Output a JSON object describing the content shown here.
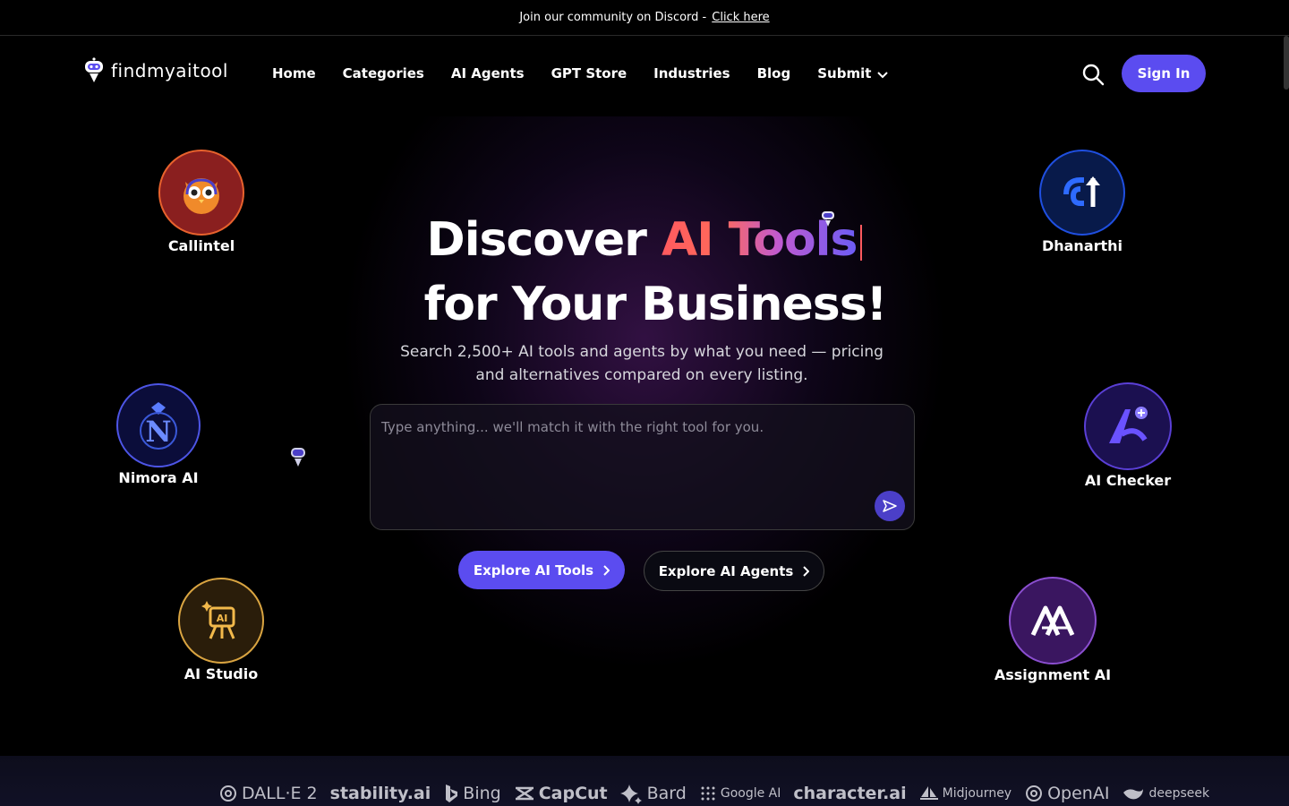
{
  "announcement": {
    "text": "Join our community on Discord -",
    "link": "Click here"
  },
  "logo": {
    "text": "findmyaitool",
    "icon": "robot-logo-icon"
  },
  "nav": {
    "items": [
      "Home",
      "Categories",
      "AI Agents",
      "GPT Store",
      "Industries",
      "Blog",
      "Submit"
    ],
    "search_icon": "search-icon",
    "signin": "Sign In"
  },
  "hero": {
    "title_part1": "Discover ",
    "title_highlight": "AI Tools",
    "title_line2": "for Your Business!",
    "subtitle": "Search 2,500+ AI tools and agents by what you need — pricing and alternatives compared on every listing.",
    "input_placeholder": "Type anything... we'll match it with the right tool for you.",
    "btn_tools": "Explore AI Tools",
    "btn_agents": "Explore AI Agents"
  },
  "tools": [
    {
      "name": "Callintel",
      "icon": "owl-icon",
      "color": "#e8622d"
    },
    {
      "name": "Dhanarthi",
      "icon": "dhanarthi-icon",
      "color": "#1f4fe0"
    },
    {
      "name": "Nimora AI",
      "icon": "nimora-icon",
      "color": "#4d55e6"
    },
    {
      "name": "AI Checker",
      "icon": "ai-checker-icon",
      "color": "#5a3fd6"
    },
    {
      "name": "AI Studio",
      "icon": "ai-studio-icon",
      "color": "#d9a441"
    },
    {
      "name": "Assignment AI",
      "icon": "assignment-icon",
      "color": "#8b4fd0"
    }
  ],
  "brands": [
    "DALL·E 2",
    "stability.ai",
    "Bing",
    "CapCut",
    "Bard",
    "Google AI",
    "character.ai",
    "Midjourney",
    "OpenAI",
    "deepseek"
  ],
  "colors": {
    "accent": "#5b4cf0",
    "background": "#000000"
  }
}
